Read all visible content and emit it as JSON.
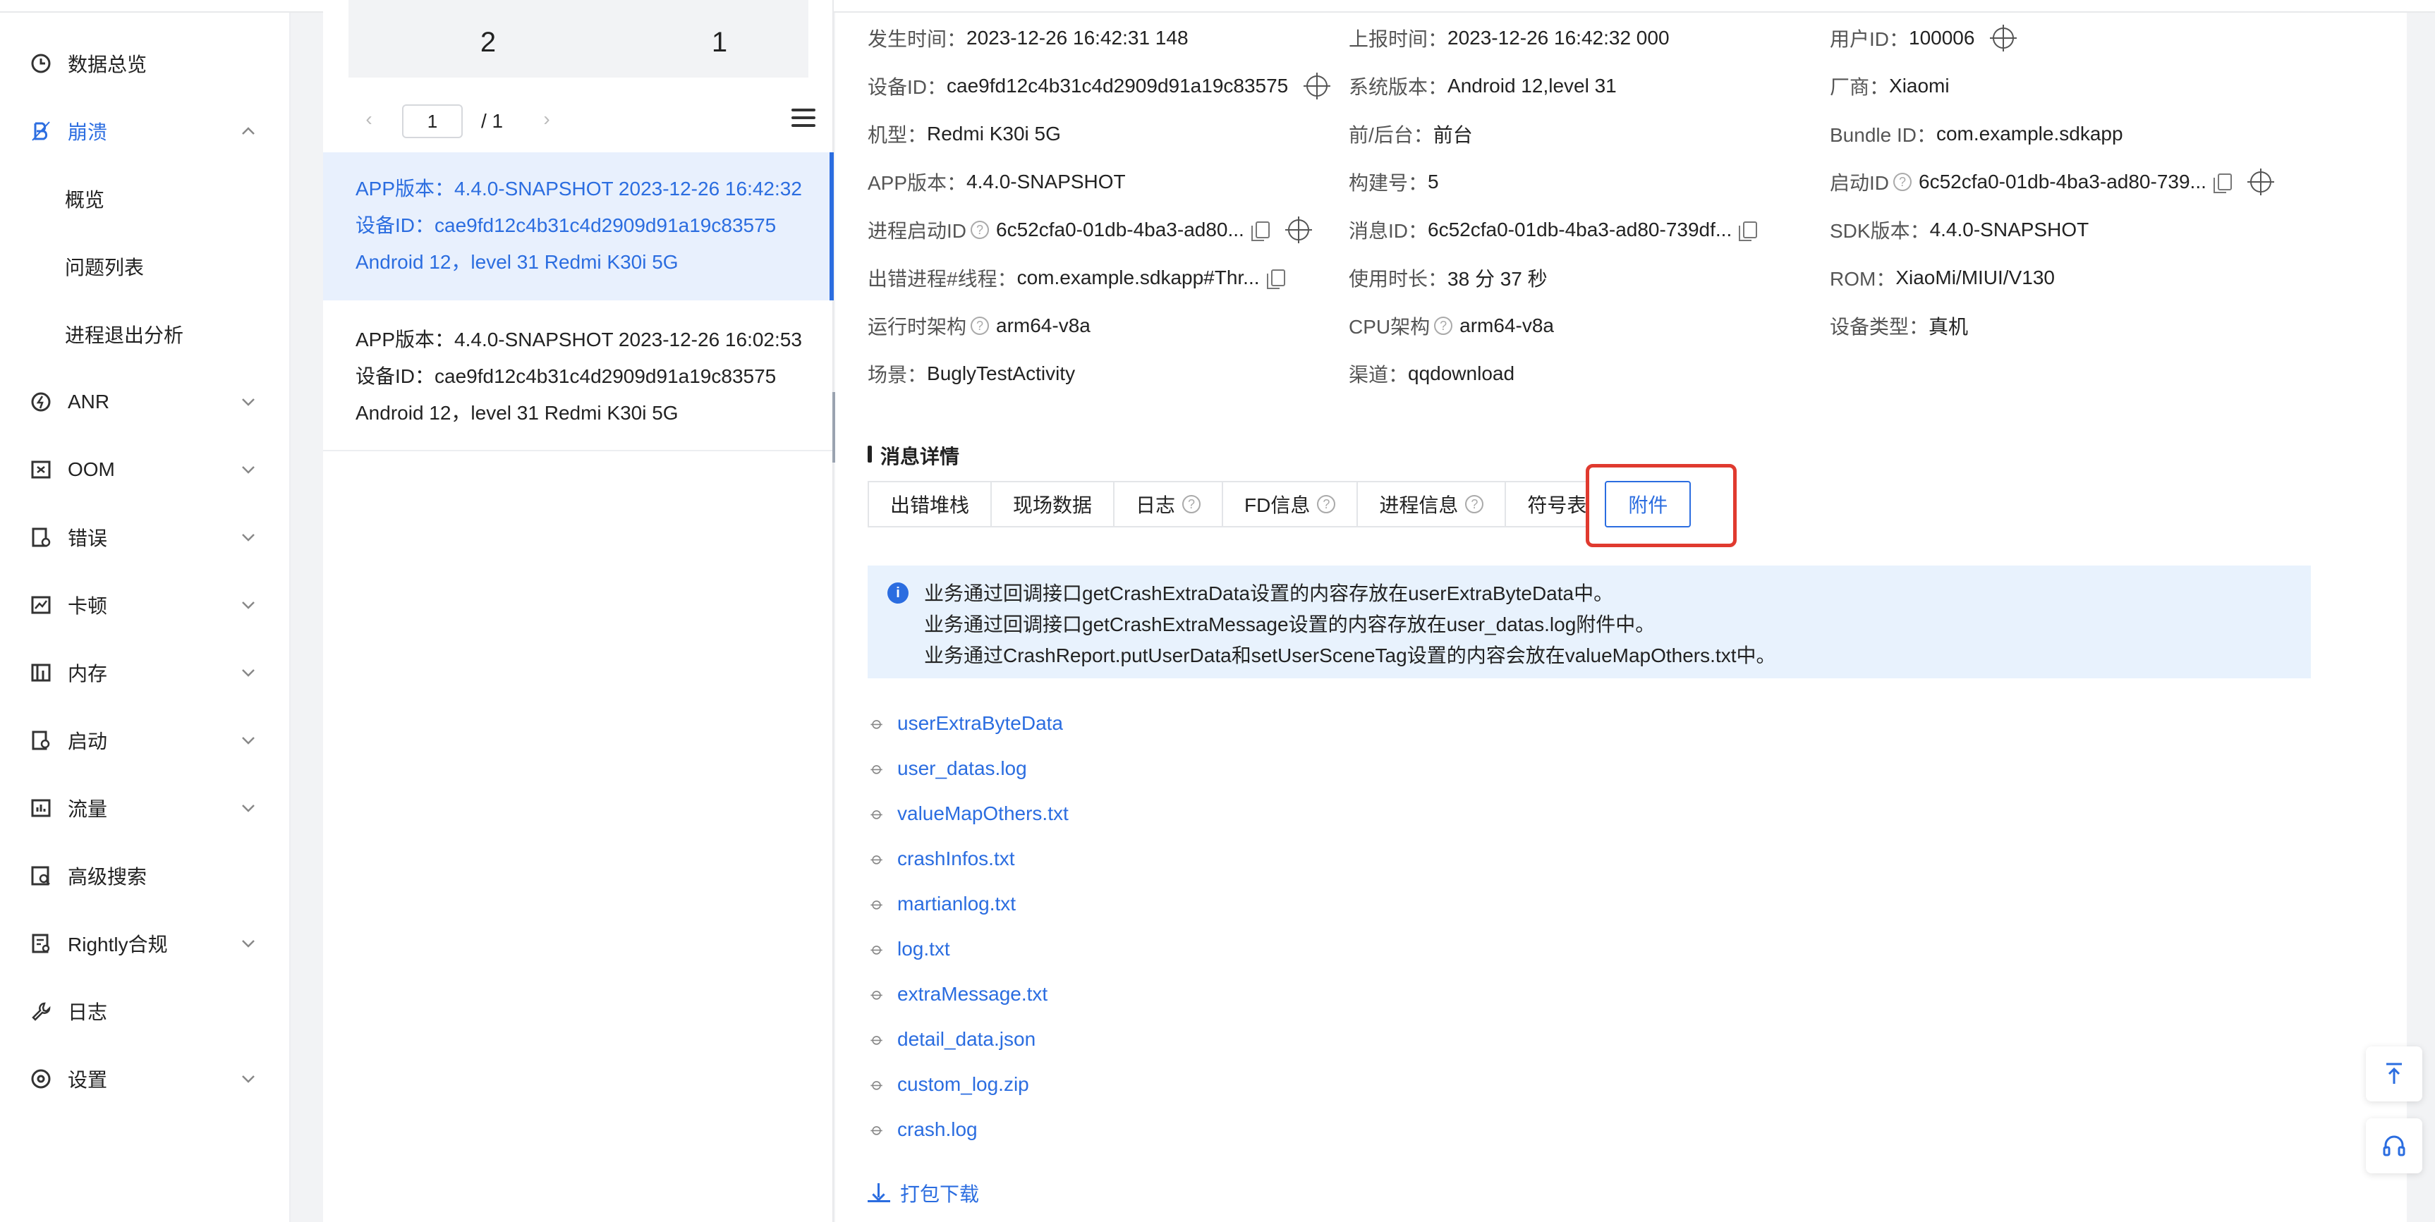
{
  "sidebar": {
    "items": [
      {
        "label": "数据总览",
        "icon": "clock-icon",
        "expandable": false
      },
      {
        "label": "崩溃",
        "icon": "crash-icon",
        "expandable": true,
        "expanded": true,
        "active": true
      },
      {
        "label": "概览"
      },
      {
        "label": "问题列表"
      },
      {
        "label": "进程退出分析"
      },
      {
        "label": "ANR",
        "icon": "anr-icon",
        "expandable": true
      },
      {
        "label": "OOM",
        "icon": "oom-icon",
        "expandable": true
      },
      {
        "label": "错误",
        "icon": "error-icon",
        "expandable": true
      },
      {
        "label": "卡顿",
        "icon": "lag-icon",
        "expandable": true
      },
      {
        "label": "内存",
        "icon": "memory-icon",
        "expandable": true
      },
      {
        "label": "启动",
        "icon": "launch-icon",
        "expandable": true
      },
      {
        "label": "流量",
        "icon": "traffic-icon",
        "expandable": true
      },
      {
        "label": "高级搜索",
        "icon": "search-icon",
        "expandable": false
      },
      {
        "label": "Rightly合规",
        "icon": "compliance-icon",
        "expandable": true
      },
      {
        "label": "日志",
        "icon": "wrench-icon",
        "expandable": false
      },
      {
        "label": "设置",
        "icon": "settings-icon",
        "expandable": true
      }
    ]
  },
  "list": {
    "stats": [
      "2",
      "1"
    ],
    "pager": {
      "current": "1",
      "total": "/ 1"
    },
    "items": [
      {
        "line1": "APP版本：4.4.0-SNAPSHOT 2023-12-26 16:42:32",
        "line2": "设备ID：cae9fd12c4b31c4d2909d91a19c83575",
        "line3": "Android 12，level 31    Redmi K30i 5G",
        "selected": true
      },
      {
        "line1": "APP版本：4.4.0-SNAPSHOT 2023-12-26 16:02:53",
        "line2": "设备ID：cae9fd12c4b31c4d2909d91a19c83575",
        "line3": "Android 12，level 31    Redmi K30i 5G",
        "selected": false
      }
    ]
  },
  "info": {
    "occur_time_k": "发生时间：",
    "occur_time_v": "2023-12-26 16:42:31 148",
    "report_time_k": "上报时间：",
    "report_time_v": "2023-12-26 16:42:32 000",
    "user_id_k": "用户ID：",
    "user_id_v": "100006",
    "device_id_k": "设备ID：",
    "device_id_v": "cae9fd12c4b31c4d2909d91a19c83575",
    "os_k": "系统版本：",
    "os_v": "Android 12,level 31",
    "vendor_k": "厂商：",
    "vendor_v": "Xiaomi",
    "model_k": "机型：",
    "model_v": "Redmi K30i 5G",
    "fg_k": "前/后台：",
    "fg_v": "前台",
    "bundle_k": "Bundle ID：",
    "bundle_v": "com.example.sdkapp",
    "app_ver_k": "APP版本：",
    "app_ver_v": "4.4.0-SNAPSHOT",
    "build_k": "构建号：",
    "build_v": "5",
    "launch_id_k": "启动ID",
    "launch_id_v": "6c52cfa0-01db-4ba3-ad80-739...",
    "proc_launch_k": "进程启动ID",
    "proc_launch_v": "6c52cfa0-01db-4ba3-ad80...",
    "msg_id_k": "消息ID：",
    "msg_id_v": "6c52cfa0-01db-4ba3-ad80-739df...",
    "sdk_k": "SDK版本：",
    "sdk_v": "4.4.0-SNAPSHOT",
    "thread_k": "出错进程#线程：",
    "thread_v": "com.example.sdkapp#Thr...",
    "duration_k": "使用时长：",
    "duration_v": "38 分 37 秒",
    "rom_k": "ROM：",
    "rom_v": "XiaoMi/MIUI/V130",
    "runtime_arch_k": "运行时架构",
    "runtime_arch_v": "arm64-v8a",
    "cpu_arch_k": "CPU架构",
    "cpu_arch_v": "arm64-v8a",
    "device_type_k": "设备类型：",
    "device_type_v": "真机",
    "scene_k": "场景：",
    "scene_v": "BuglyTestActivity",
    "channel_k": "渠道：",
    "channel_v": "qqdownload"
  },
  "detail": {
    "section_title": "消息详情",
    "tabs": [
      "出错堆栈",
      "现场数据",
      "日志",
      "FD信息",
      "进程信息",
      "符号表",
      "附件"
    ],
    "active_tab": "附件",
    "notice": [
      "业务通过回调接口getCrashExtraData设置的内容存放在userExtraByteData中。",
      "业务通过回调接口getCrashExtraMessage设置的内容存放在user_datas.log附件中。",
      "业务通过CrashReport.putUserData和setUserSceneTag设置的内容会放在valueMapOthers.txt中。"
    ],
    "attachments": [
      "userExtraByteData",
      "user_datas.log",
      "valueMapOthers.txt",
      "crashInfos.txt",
      "martianlog.txt",
      "log.txt",
      "extraMessage.txt",
      "detail_data.json",
      "custom_log.zip",
      "crash.log"
    ],
    "download_label": "打包下载"
  },
  "colors": {
    "accent": "#2b6de0",
    "highlight": "#e03a2f",
    "notice_bg": "#e8f2fd"
  }
}
